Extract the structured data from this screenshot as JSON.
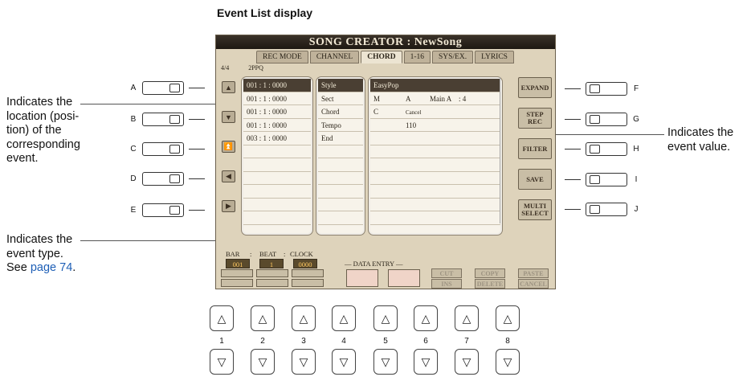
{
  "heading": "Event List display",
  "annotations": {
    "location": [
      "Indicates the",
      "location (posi-",
      "tion) of the",
      "corresponding",
      "event."
    ],
    "event_type": [
      "Indicates the",
      "event type.",
      "See"
    ],
    "event_type_link": "page 74",
    "event_type_end": ".",
    "event_value": [
      "Indicates the",
      "event value."
    ]
  },
  "lcd": {
    "title": "SONG CREATOR : NewSong",
    "tabs": [
      "REC MODE",
      "CHANNEL",
      "CHORD",
      "1-16",
      "SYS/EX.",
      "LYRICS"
    ],
    "active_tab": "CHORD",
    "info": [
      "4/4",
      "2PPQ"
    ],
    "locations": [
      "001 : 1 : 0000",
      "001 : 1 : 0000",
      "001 : 1 : 0000",
      "001 : 1 : 0000",
      "003 : 1 : 0000"
    ],
    "types": [
      "Style",
      "Sect",
      "Chord",
      "Tempo",
      "End"
    ],
    "values": [
      [
        "EasyPop",
        "",
        "",
        ""
      ],
      [
        "M",
        "A",
        "Main A",
        ": 4"
      ],
      [
        "C",
        "Cancel",
        "",
        ""
      ],
      [
        "",
        "110",
        "",
        ""
      ]
    ],
    "fn_buttons": [
      "EXPAND",
      "STEP REC",
      "FILTER",
      "SAVE",
      "MULTI SELECT"
    ],
    "bar_label": "BAR",
    "beat_label": "BEAT",
    "clock_label": "CLOCK",
    "bar_value": "001",
    "beat_value": "1",
    "clock_value": "0000",
    "data_entry_label": "DATA ENTRY",
    "edit_buttons": [
      "CUT",
      "COPY",
      "PASTE",
      "INS",
      "DELETE",
      "CANCEL"
    ]
  },
  "side_left": [
    "A",
    "B",
    "C",
    "D",
    "E"
  ],
  "side_right": [
    "F",
    "G",
    "H",
    "I",
    "J"
  ],
  "bottom_numbers": [
    "1",
    "2",
    "3",
    "4",
    "5",
    "6",
    "7",
    "8"
  ],
  "icons": {
    "up": "triangle-up-icon",
    "down": "triangle-down-icon",
    "left": "triangle-left-icon",
    "right": "triangle-right-icon"
  }
}
